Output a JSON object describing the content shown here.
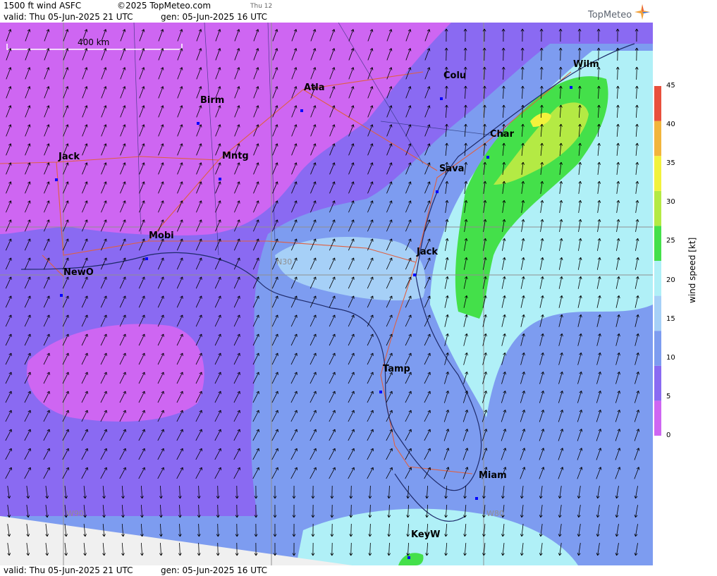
{
  "header": {
    "product": "1500 ft wind ASFC",
    "copyright": "©2025 TopMeteo.com",
    "day_tab": "Thu 12",
    "valid": "valid:  Thu  05-Jun-2025  21 UTC",
    "gen": "gen: 05-Jun-2025 16 UTC",
    "logo": "TopMeteo"
  },
  "footer": {
    "valid": "valid:  Thu  05-Jun-2025  21 UTC",
    "gen": "gen: 05-Jun-2025 16 UTC"
  },
  "scale_bar": "400 km",
  "grid_labels": {
    "lat": "N30",
    "lon1": "W90",
    "lon2": "W80"
  },
  "cities": [
    {
      "name": "Atla"
    },
    {
      "name": "Colu"
    },
    {
      "name": "Wilm"
    },
    {
      "name": "Birm"
    },
    {
      "name": "Char"
    },
    {
      "name": "Jack"
    },
    {
      "name": "Mntg"
    },
    {
      "name": "Sava"
    },
    {
      "name": "Mobi"
    },
    {
      "name": "Jack"
    },
    {
      "name": "NewO"
    },
    {
      "name": "Tamp"
    },
    {
      "name": "Miam"
    },
    {
      "name": "KeyW"
    }
  ],
  "legend": {
    "title": "wind speed  [kt]",
    "ticks": [
      "45",
      "40",
      "35",
      "30",
      "25",
      "20",
      "15",
      "10",
      "5",
      "0"
    ],
    "colors": [
      "#ce66f2",
      "#8a6af2",
      "#7d9cf0",
      "#a6d0f7",
      "#b0f0f7",
      "#44e04a",
      "#b4ea44",
      "#f2f23c",
      "#f2b53c",
      "#e8503c"
    ]
  }
}
